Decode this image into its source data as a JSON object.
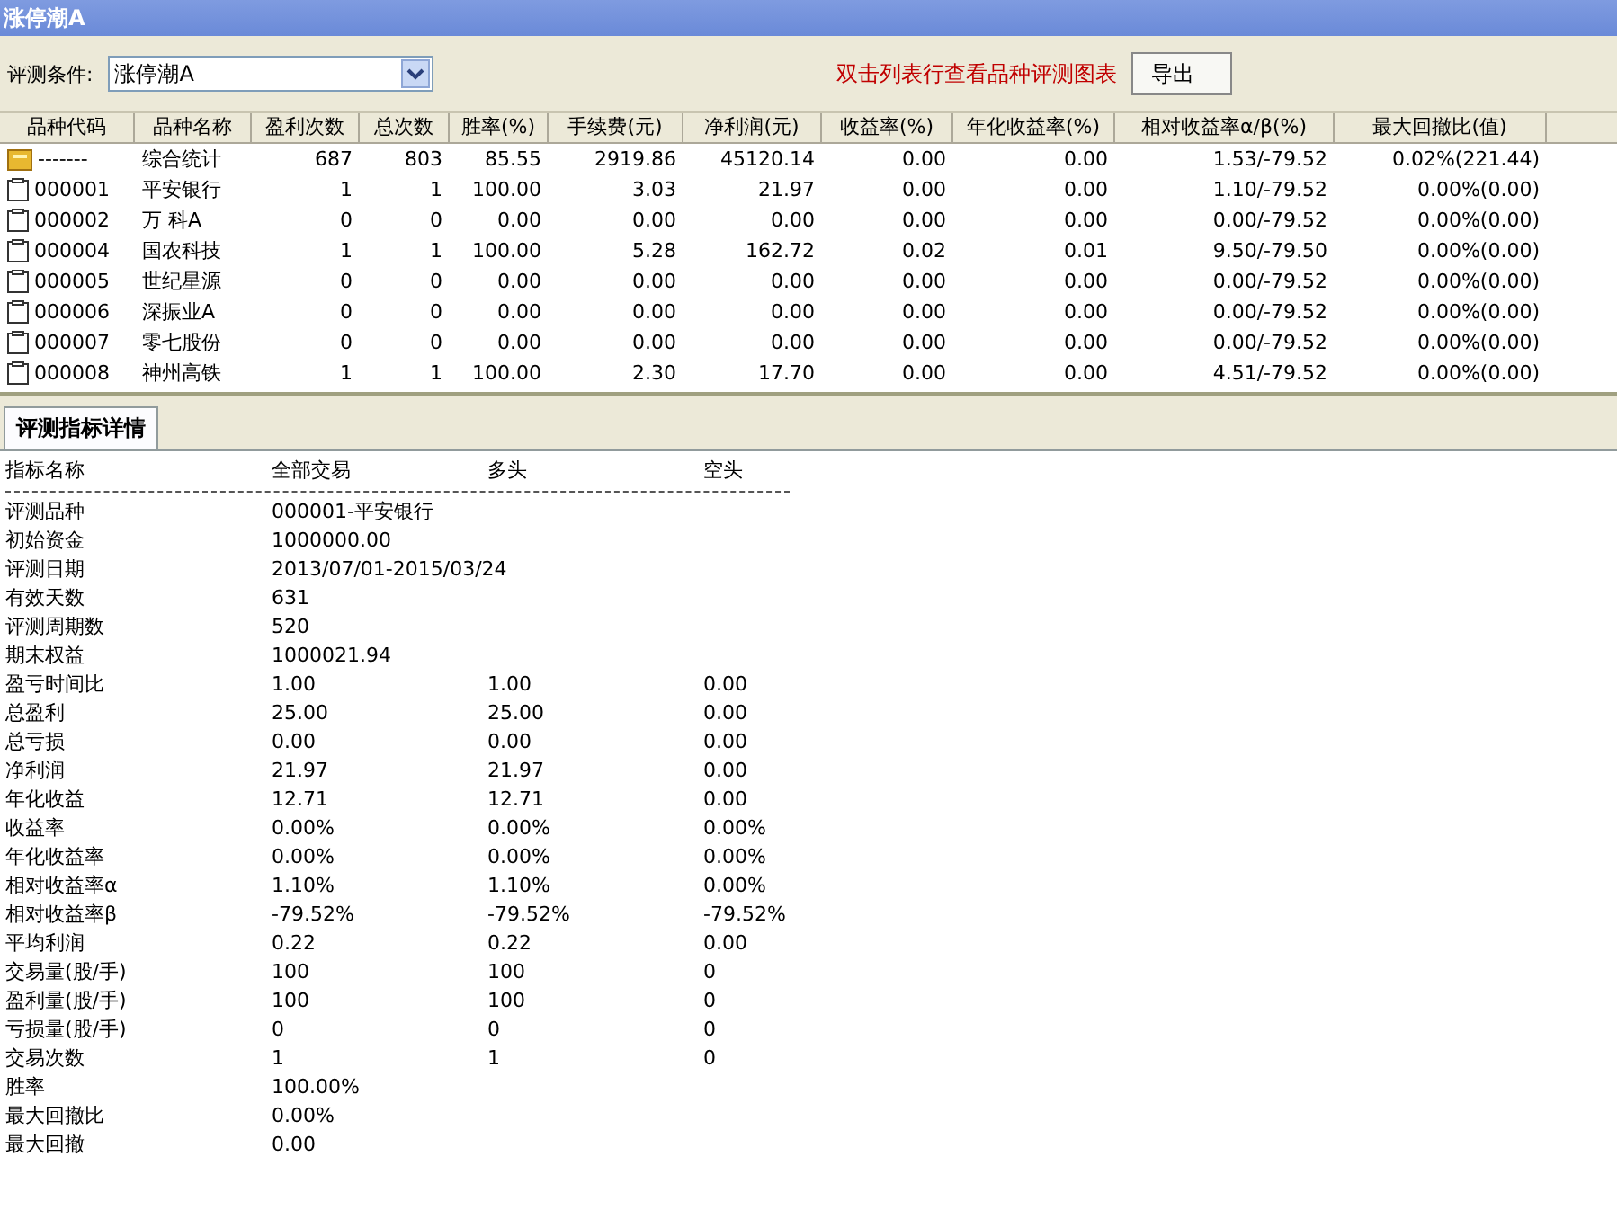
{
  "window": {
    "title": "涨停潮A"
  },
  "toolbar": {
    "condition_label": "评测条件:",
    "condition_value": "涨停潮A",
    "hint": "双击列表行查看品种评测图表",
    "export_button": "导出"
  },
  "table": {
    "columns": [
      "品种代码",
      "品种名称",
      "盈利次数",
      "总次数",
      "胜率(%)",
      "手续费(元)",
      "净利润(元)",
      "收益率(%)",
      "年化收益率(%)",
      "相对收益率α/β(%)",
      "最大回撤比(值)"
    ],
    "rows": [
      {
        "kind": "summary",
        "selected": false,
        "cells": [
          "-------",
          "综合统计",
          "687",
          "803",
          "85.55",
          "2919.86",
          "45120.14",
          "0.00",
          "0.00",
          "1.53/-79.52",
          "0.02%(221.44)"
        ]
      },
      {
        "kind": "stock",
        "selected": false,
        "cells": [
          "000001",
          "平安银行",
          "1",
          "1",
          "100.00",
          "3.03",
          "21.97",
          "0.00",
          "0.00",
          "1.10/-79.52",
          "0.00%(0.00)"
        ]
      },
      {
        "kind": "stock",
        "selected": false,
        "cells": [
          "000002",
          "万  科A",
          "0",
          "0",
          "0.00",
          "0.00",
          "0.00",
          "0.00",
          "0.00",
          "0.00/-79.52",
          "0.00%(0.00)"
        ]
      },
      {
        "kind": "stock",
        "selected": false,
        "cells": [
          "000004",
          "国农科技",
          "1",
          "1",
          "100.00",
          "5.28",
          "162.72",
          "0.02",
          "0.01",
          "9.50/-79.50",
          "0.00%(0.00)"
        ]
      },
      {
        "kind": "stock",
        "selected": false,
        "cells": [
          "000005",
          "世纪星源",
          "0",
          "0",
          "0.00",
          "0.00",
          "0.00",
          "0.00",
          "0.00",
          "0.00/-79.52",
          "0.00%(0.00)"
        ]
      },
      {
        "kind": "stock",
        "selected": false,
        "cells": [
          "000006",
          "深振业A",
          "0",
          "0",
          "0.00",
          "0.00",
          "0.00",
          "0.00",
          "0.00",
          "0.00/-79.52",
          "0.00%(0.00)"
        ]
      },
      {
        "kind": "stock",
        "selected": false,
        "cells": [
          "000007",
          "零七股份",
          "0",
          "0",
          "0.00",
          "0.00",
          "0.00",
          "0.00",
          "0.00",
          "0.00/-79.52",
          "0.00%(0.00)"
        ]
      },
      {
        "kind": "stock",
        "selected": false,
        "cells": [
          "000008",
          "神州高铁",
          "1",
          "1",
          "100.00",
          "2.30",
          "17.70",
          "0.00",
          "0.00",
          "4.51/-79.52",
          "0.00%(0.00)"
        ]
      }
    ]
  },
  "details": {
    "tab": {
      "label": "评测指标详情",
      "selected": true
    },
    "columns": [
      "指标名称",
      "全部交易",
      "多头",
      "空头"
    ],
    "rows": [
      [
        "评测品种",
        "000001-平安银行",
        "",
        ""
      ],
      [
        "初始资金",
        "1000000.00",
        "",
        ""
      ],
      [
        "评测日期",
        "2013/07/01-2015/03/24",
        "",
        ""
      ],
      [
        "有效天数",
        "631",
        "",
        ""
      ],
      [
        "评测周期数",
        "520",
        "",
        ""
      ],
      [
        "期末权益",
        "1000021.94",
        "",
        ""
      ],
      [
        "盈亏时间比",
        "1.00",
        "1.00",
        "0.00"
      ],
      [
        "总盈利",
        "25.00",
        "25.00",
        "0.00"
      ],
      [
        "总亏损",
        "0.00",
        "0.00",
        "0.00"
      ],
      [
        "净利润",
        "21.97",
        "21.97",
        "0.00"
      ],
      [
        "年化收益",
        "12.71",
        "12.71",
        "0.00"
      ],
      [
        "收益率",
        "0.00%",
        "0.00%",
        "0.00%"
      ],
      [
        "年化收益率",
        "0.00%",
        "0.00%",
        "0.00%"
      ],
      [
        "相对收益率α",
        "1.10%",
        "1.10%",
        "0.00%"
      ],
      [
        "相对收益率β",
        "-79.52%",
        "-79.52%",
        "-79.52%"
      ],
      [
        "平均利润",
        "0.22",
        "0.22",
        "0.00"
      ],
      [
        "交易量(股/手)",
        "100",
        "100",
        "0"
      ],
      [
        "盈利量(股/手)",
        "100",
        "100",
        "0"
      ],
      [
        "亏损量(股/手)",
        "0",
        "0",
        "0"
      ],
      [
        "交易次数",
        "1",
        "1",
        "0"
      ],
      [
        "胜率",
        "100.00%",
        "",
        ""
      ],
      [
        "最大回撤比",
        "0.00%",
        "",
        ""
      ],
      [
        "最大回撤",
        "0.00",
        "",
        ""
      ]
    ]
  }
}
